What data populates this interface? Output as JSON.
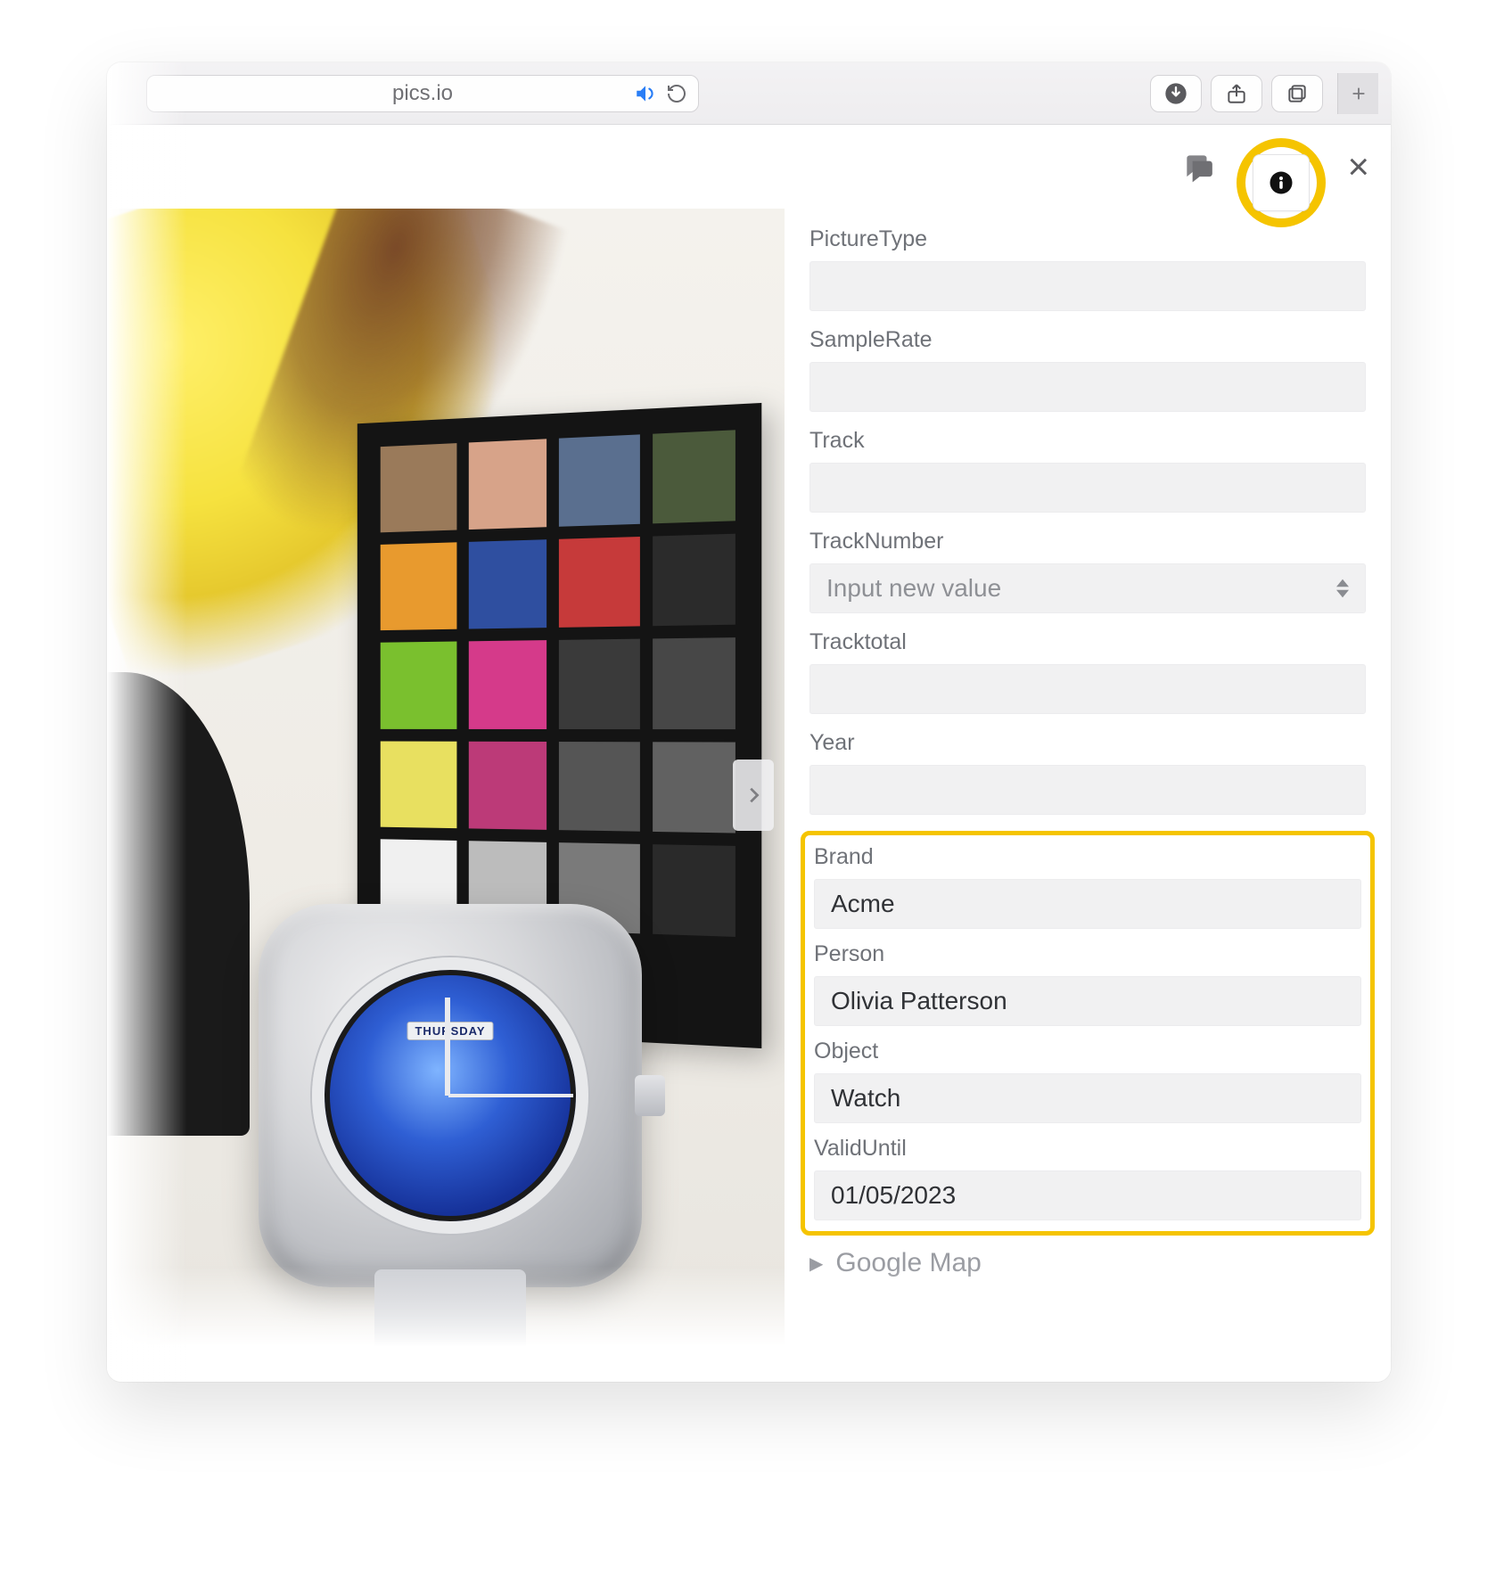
{
  "browser": {
    "domain": "pics.io"
  },
  "panel": {
    "fields": [
      {
        "label": "PictureType",
        "value": "",
        "type": "text"
      },
      {
        "label": "SampleRate",
        "value": "",
        "type": "text"
      },
      {
        "label": "Track",
        "value": "",
        "type": "text"
      },
      {
        "label": "TrackNumber",
        "value": "",
        "type": "select",
        "placeholder": "Input new value"
      },
      {
        "label": "Tracktotal",
        "value": "",
        "type": "text"
      },
      {
        "label": "Year",
        "value": "",
        "type": "text"
      }
    ],
    "highlighted_fields": [
      {
        "label": "Brand",
        "value": "Acme"
      },
      {
        "label": "Person",
        "value": "Olivia Patterson"
      },
      {
        "label": "Object",
        "value": "Watch"
      },
      {
        "label": "ValidUntil",
        "value": "01/05/2023"
      }
    ],
    "collapsed_section": "Google Map"
  },
  "preview": {
    "watch_day": "THURSDAY"
  },
  "colors": {
    "highlight": "#f5c400"
  }
}
